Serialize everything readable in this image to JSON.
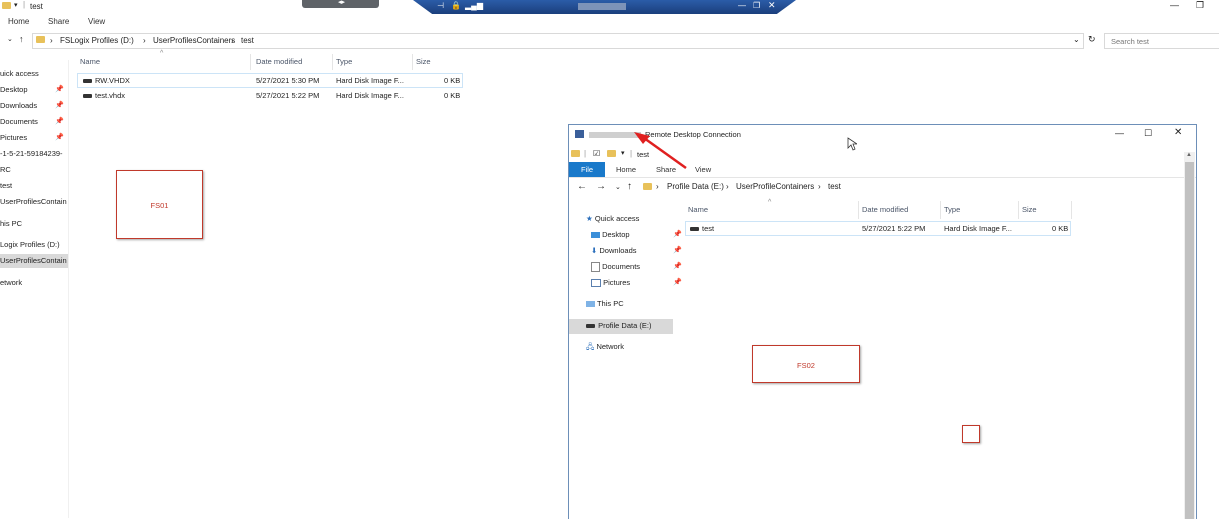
{
  "outer": {
    "title": "test",
    "ribbon_tabs": [
      "Home",
      "Share",
      "View"
    ],
    "breadcrumb": [
      "FSLogix Profiles (D:)",
      "UserProfilesContainers",
      "test"
    ],
    "search_placeholder": "Search test",
    "nav": [
      {
        "label": "uick access",
        "pinned": false,
        "selected": false
      },
      {
        "label": "Desktop",
        "pinned": true,
        "selected": false
      },
      {
        "label": "Downloads",
        "pinned": true,
        "selected": false
      },
      {
        "label": "Documents",
        "pinned": true,
        "selected": false
      },
      {
        "label": "Pictures",
        "pinned": true,
        "selected": false
      },
      {
        "label": "-1-5-21-59184239-",
        "pinned": false,
        "selected": false
      },
      {
        "label": "RC",
        "pinned": false,
        "selected": false
      },
      {
        "label": "test",
        "pinned": false,
        "selected": false
      },
      {
        "label": "UserProfilesContain",
        "pinned": false,
        "selected": false
      },
      {
        "label": "his PC",
        "pinned": false,
        "selected": false
      },
      {
        "label": "Logix Profiles (D:)",
        "pinned": false,
        "selected": false
      },
      {
        "label": "UserProfilesContain",
        "pinned": false,
        "selected": true
      },
      {
        "label": "etwork",
        "pinned": false,
        "selected": false
      }
    ],
    "columns": [
      "Name",
      "Date modified",
      "Type",
      "Size"
    ],
    "files": [
      {
        "name": "RW.VHDX",
        "date": "5/27/2021 5:30 PM",
        "type": "Hard Disk Image F...",
        "size": "0 KB"
      },
      {
        "name": "test.vhdx",
        "date": "5/27/2021 5:22 PM",
        "type": "Hard Disk Image F...",
        "size": "0 KB"
      }
    ],
    "annotation": "FS01"
  },
  "rdp": {
    "title": "Remote Desktop Connection",
    "qat_title": "test",
    "ribbon_tabs": [
      "File",
      "Home",
      "Share",
      "View"
    ],
    "breadcrumb": [
      "Profile Data (E:)",
      "UserProfileContainers",
      "test"
    ],
    "nav": {
      "quick_access": "Quick access",
      "desktop": "Desktop",
      "downloads": "Downloads",
      "documents": "Documents",
      "pictures": "Pictures",
      "this_pc": "This PC",
      "profile_data": "Profile Data (E:)",
      "network": "Network"
    },
    "columns": [
      "Name",
      "Date modified",
      "Type",
      "Size"
    ],
    "files": [
      {
        "name": "test",
        "date": "5/27/2021 5:22 PM",
        "type": "Hard Disk Image F...",
        "size": "0 KB"
      }
    ],
    "annotation": "FS02"
  },
  "colors": {
    "annotation": "#c0392b",
    "accent": "#1979ca",
    "rdp_bar": "#2b5ca8"
  }
}
